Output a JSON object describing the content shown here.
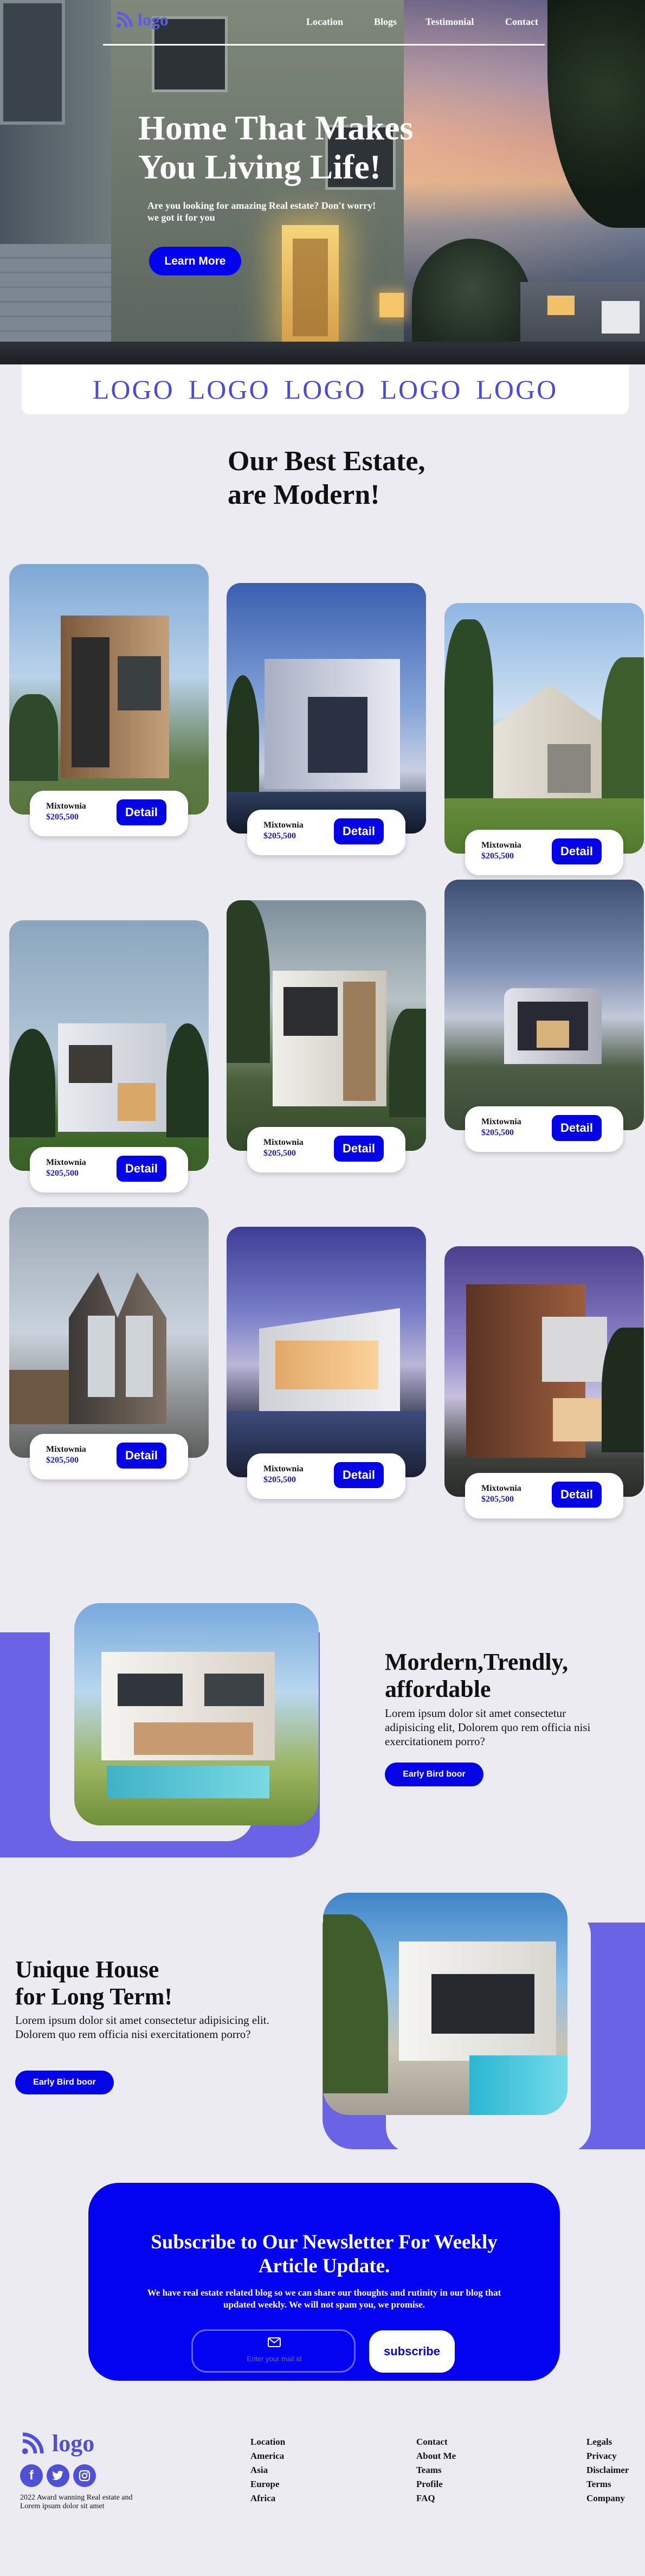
{
  "colors": {
    "accent": "#0404e6",
    "purple": "#6a63e6",
    "logo": "#4b4bd9",
    "background": "#edebf2"
  },
  "nav": {
    "logo_text": "logo",
    "links": [
      "Location",
      "Blogs",
      "Testimonial",
      "Contact"
    ]
  },
  "hero": {
    "title_line1": "Home That Makes",
    "title_line2": "You Living Life!",
    "subtitle": "Are you looking for amazing Real estate? Don't worry! we got it for you",
    "cta": "Learn More"
  },
  "logo_bar": [
    "LOGO",
    "LOGO",
    "LOGO",
    "LOGO",
    "LOGO"
  ],
  "estates": {
    "title_line1": "Our Best Estate,",
    "title_line2": "are Modern!",
    "cards": [
      {
        "name": "Mixtownia",
        "price": "$205,500",
        "button": "Detail"
      },
      {
        "name": "Mixtownia",
        "price": "$205,500",
        "button": "Detail"
      },
      {
        "name": "Mixtownia",
        "price": "$205,500",
        "button": "Detail"
      },
      {
        "name": "Mixtownia",
        "price": "$205,500",
        "button": "Detail"
      },
      {
        "name": "Mixtownia",
        "price": "$205,500",
        "button": "Detail"
      },
      {
        "name": "Mixtownia",
        "price": "$205,500",
        "button": "Detail"
      },
      {
        "name": "Mixtownia",
        "price": "$205,500",
        "button": "Detail"
      },
      {
        "name": "Mixtownia",
        "price": "$205,500",
        "button": "Detail"
      },
      {
        "name": "Mixtownia",
        "price": "$205,500",
        "button": "Detail"
      }
    ]
  },
  "feature1": {
    "title_line1": "Mordern,Trendly,",
    "title_line2": "affordable",
    "text": "Lorem ipsum dolor sit amet consectetur adipisicing elit, Dolorem quo rem officia nisi exercitationem porro?",
    "button": "Early Bird boor"
  },
  "feature2": {
    "title_line1": "Unique House",
    "title_line2": "for Long Term!",
    "text": "Lorem ipsum dolor sit amet consectetur adipisicing elit. Dolorem quo rem officia nisi exercitationem porro?",
    "button": "Early Bird boor"
  },
  "newsletter": {
    "title": "Subscribe to Our Newsletter For Weekly Article Update.",
    "text": "We have real estate related blog so we can share our thoughts and rutinity in our blog that updated weekly. We will not spam you, we promise.",
    "placeholder": "Enter your mail id",
    "icon": "envelope-icon",
    "button": "subscribe"
  },
  "footer": {
    "logo_text": "logo",
    "tagline": "2022 Award wanning Real estate and Lorem ipsum dolor sit amet",
    "social": [
      "facebook-icon",
      "twitter-icon",
      "instagram-icon"
    ],
    "col1": [
      "Location",
      "America",
      "Asia",
      "Europe",
      "Africa"
    ],
    "col2": [
      "Contact",
      "About Me",
      "Teams",
      "Profile",
      "FAQ"
    ],
    "col3": [
      "Legals",
      "Privacy",
      "Disclaimer",
      "Terms",
      "Company"
    ]
  }
}
